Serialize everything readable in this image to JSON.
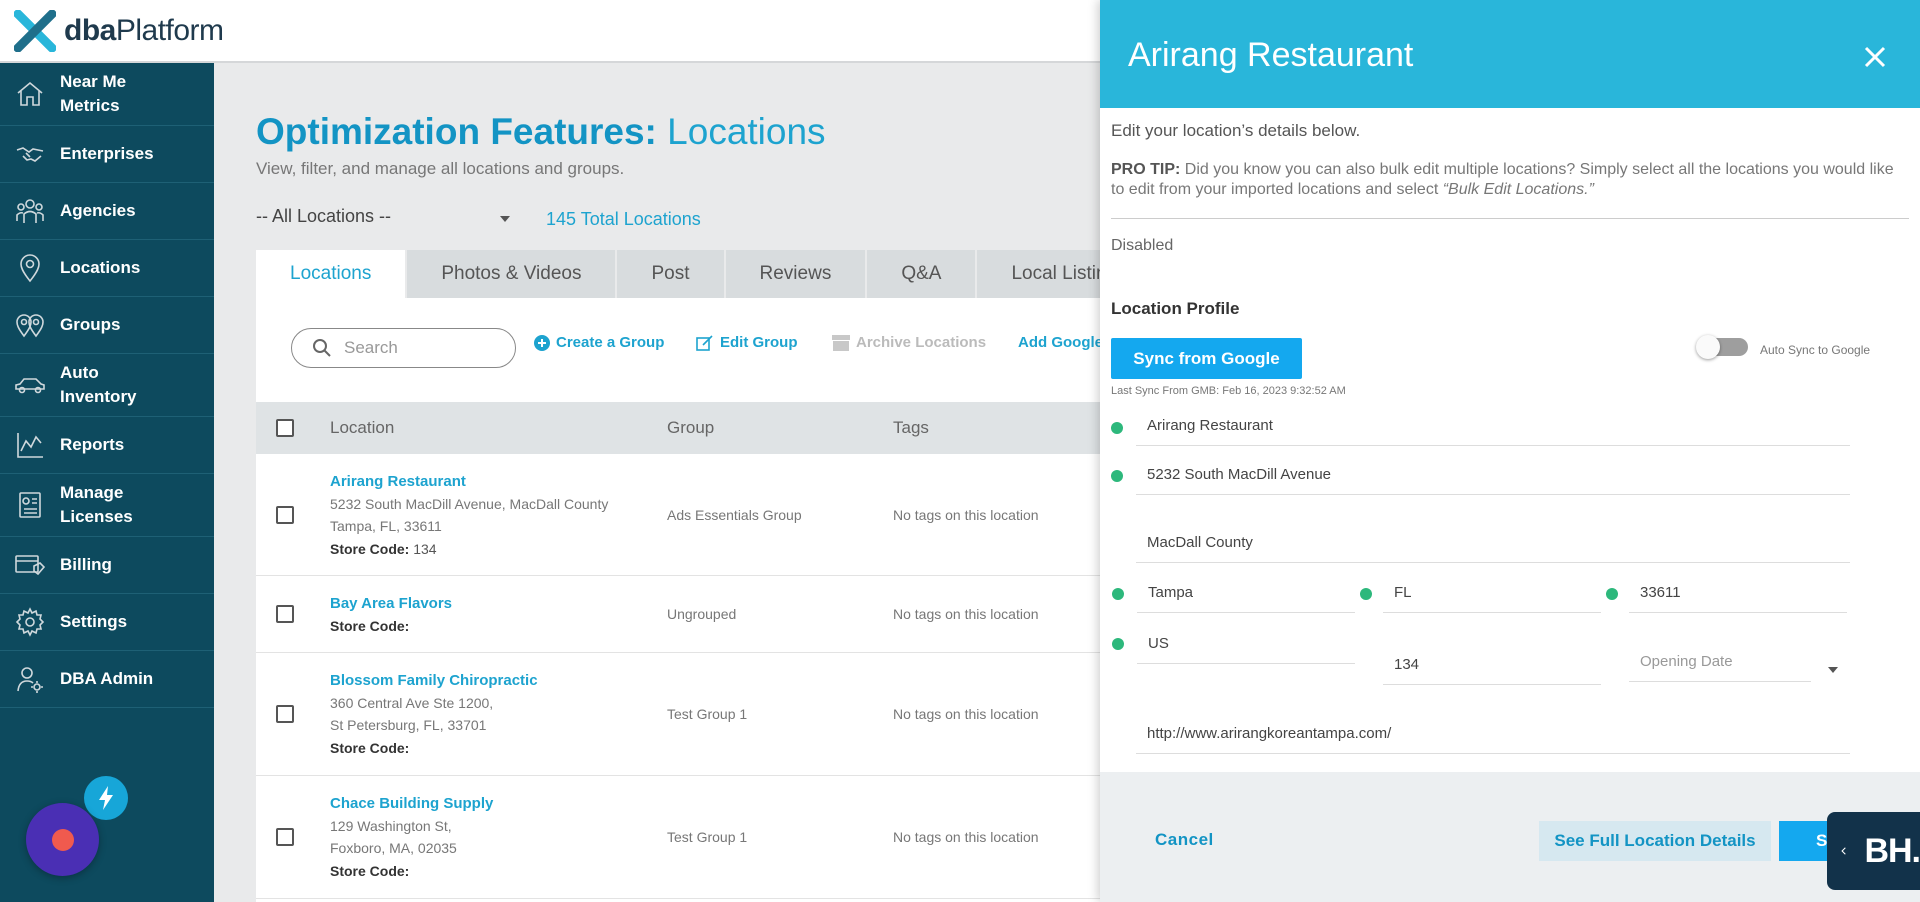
{
  "header": {
    "logo_bold": "dba",
    "logo_light": "Platform"
  },
  "sidebar": {
    "items": [
      {
        "label": "Near Me\nMetrics",
        "icon": "home-icon"
      },
      {
        "label": "Enterprises",
        "icon": "handshake-icon"
      },
      {
        "label": "Agencies",
        "icon": "users-icon"
      },
      {
        "label": "Locations",
        "icon": "map-pin-icon"
      },
      {
        "label": "Groups",
        "icon": "pins-icon"
      },
      {
        "label": "Auto\nInventory",
        "icon": "car-icon"
      },
      {
        "label": "Reports",
        "icon": "chart-icon"
      },
      {
        "label": "Manage\nLicenses",
        "icon": "license-icon"
      },
      {
        "label": "Billing",
        "icon": "billing-icon"
      },
      {
        "label": "Settings",
        "icon": "gear-icon"
      },
      {
        "label": "DBA Admin",
        "icon": "admin-user-icon"
      }
    ]
  },
  "main": {
    "title_bold": "Optimization Features:",
    "title_light": "Locations",
    "subtitle": "View, filter, and manage all locations and groups.",
    "location_filter": "-- All Locations --",
    "total": "145 Total Locations",
    "tabs": [
      "Locations",
      "Photos & Videos",
      "Post",
      "Reviews",
      "Q&A",
      "Local Listin"
    ],
    "search_placeholder": "Search",
    "actions": {
      "create_group": "Create a Group",
      "edit_group": "Edit Group",
      "archive": "Archive Locations",
      "add_google": "Add Google"
    },
    "columns": {
      "location": "Location",
      "group": "Group",
      "tags": "Tags"
    },
    "rows": [
      {
        "name": "Arirang Restaurant",
        "addr1": "5232 South MacDill Avenue, MacDall County",
        "addr2": "Tampa, FL, 33611",
        "store_code_label": "Store Code:",
        "store_code": "134",
        "group": "Ads Essentials Group",
        "tags": "No tags on this location"
      },
      {
        "name": "Bay Area Flavors",
        "store_code_label": "Store Code:",
        "store_code": "",
        "group": "Ungrouped",
        "tags": "No tags on this location"
      },
      {
        "name": "Blossom Family Chiropractic",
        "addr1": "360 Central Ave Ste 1200,",
        "addr2": "St Petersburg, FL, 33701",
        "store_code_label": "Store Code:",
        "store_code": "",
        "group": "Test Group 1",
        "tags": "No tags on this location"
      },
      {
        "name": "Chace Building Supply",
        "addr1": "129 Washington St,",
        "addr2": "Foxboro, MA, 02035",
        "store_code_label": "Store Code:",
        "store_code": "",
        "group": "Test Group 1",
        "tags": "No tags on this location"
      }
    ]
  },
  "drawer": {
    "title": "Arirang Restaurant",
    "intro": "Edit your location’s details below.",
    "tip_label": "PRO TIP:",
    "tip_text": " Did you know you can also bulk edit multiple locations? Simply select all the locations you would like to edit from your imported locations and select ",
    "tip_em": "“Bulk Edit Locations.”",
    "status": "Disabled",
    "section": "Location Profile",
    "sync_button": "Sync from Google",
    "last_sync": "Last Sync From GMB: Feb 16, 2023 9:32:52 AM",
    "auto_sync_label": "Auto Sync to Google",
    "auto_sync_on": false,
    "fields": {
      "name": "Arirang Restaurant",
      "address1": "5232 South MacDill Avenue",
      "address2": "MacDall County",
      "city": "Tampa",
      "state": "FL",
      "zip": "33611",
      "country": "US",
      "store_code": "134",
      "opening_date_placeholder": "Opening Date",
      "website": "http://www.arirangkoreantampa.com/"
    },
    "cancel": "Cancel",
    "see_full": "See Full Location Details",
    "save": "Save",
    "badge": "BH."
  },
  "colors": {
    "accent": "#1da3cf",
    "sidebar": "#0d4a5e",
    "drawer_header": "#29b6da",
    "button": "#14a8ef",
    "status_dot": "#2db87c"
  }
}
